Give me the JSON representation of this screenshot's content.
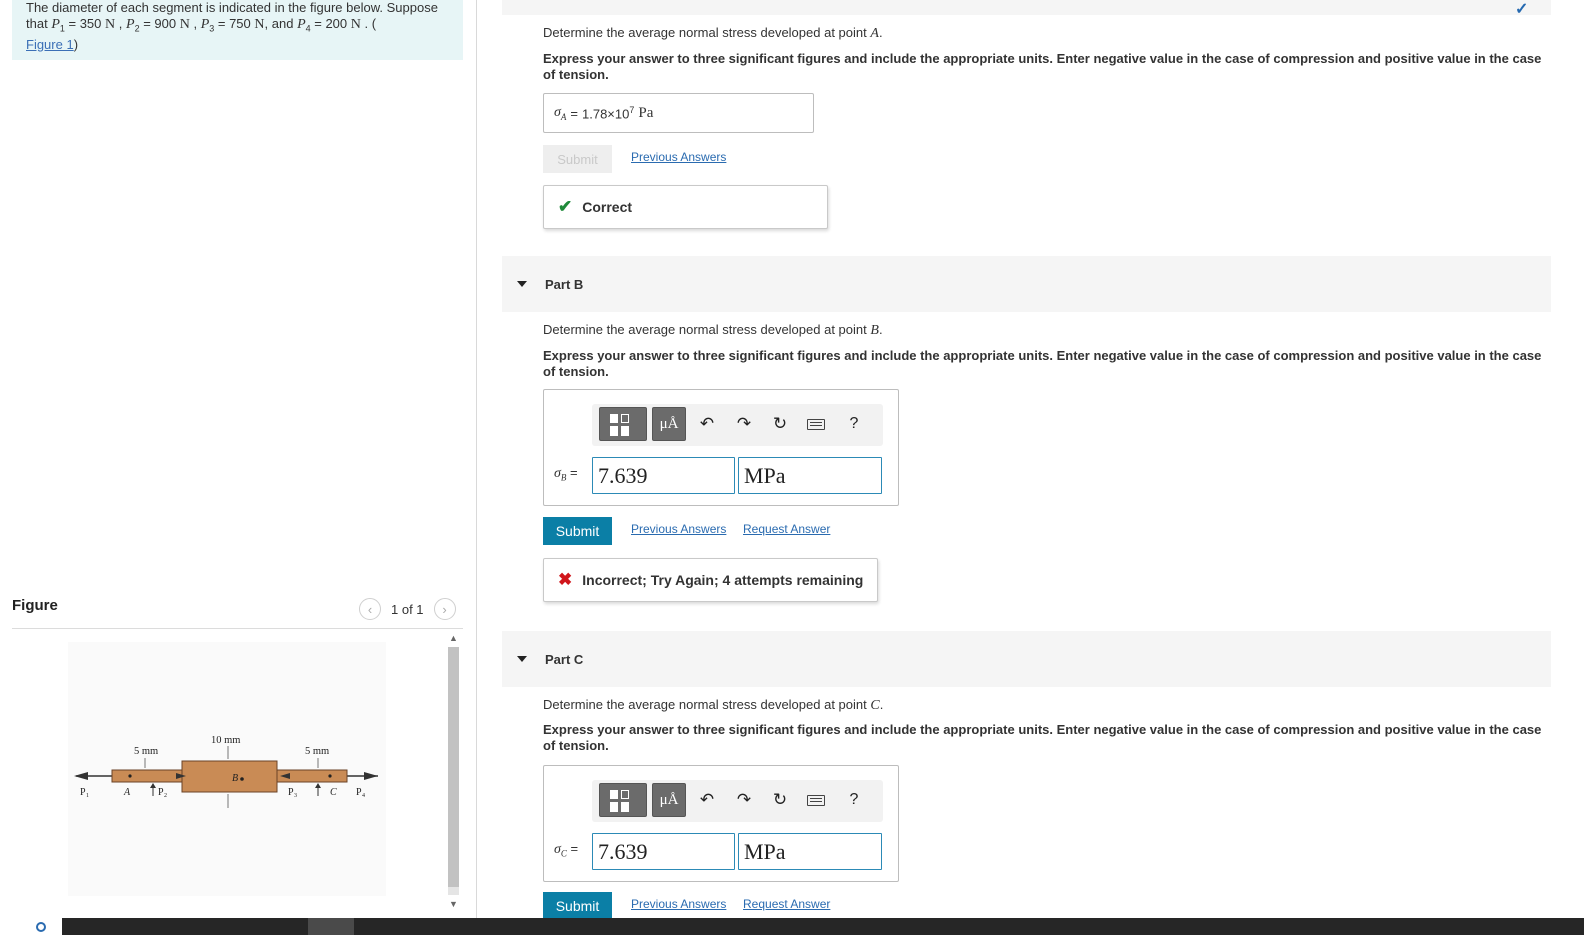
{
  "problem": {
    "line1": "The diameter of each segment is indicated in the figure below. Suppose",
    "line2_prefix": "that",
    "p1_var": "P",
    "p1_sub": "1",
    "p1_val": " = 350 ",
    "p2_var": "P",
    "p2_sub": "2",
    "p2_val": " = 900 ",
    "p3_var": "P",
    "p3_sub": "3",
    "p3_val": " = 750 ",
    "p4_var": "P",
    "p4_sub": "4",
    "p4_val": " = 200 ",
    "unit": "N",
    "and": ", and",
    "comma": " ,",
    "tail": " . (",
    "figure_link": "Figure 1",
    "close": ")"
  },
  "figure": {
    "title": "Figure",
    "pager": "1 of 1",
    "labels": {
      "left_dia": "5 mm",
      "mid_dia": "10 mm",
      "right_dia": "5 mm",
      "p1": "P",
      "p2": "P",
      "p3": "P",
      "p4": "P",
      "sub1": "1",
      "sub2": "2",
      "sub3": "3",
      "sub4": "4",
      "a": "A",
      "b": "B",
      "c": "C"
    }
  },
  "part_a": {
    "question": "Determine the average normal stress developed at point",
    "point": "A",
    "period": ".",
    "instructions": "Express your answer to three significant figures and include the appropriate units. Enter negative value in the case of compression and positive value in the case of tension.",
    "symbol": "σ",
    "symbol_sub": "A",
    "eq": " = ",
    "value": "1.78×10",
    "exp": "7",
    "unit": "Pa",
    "submit": "Submit",
    "previous": "Previous Answers",
    "feedback": "Correct"
  },
  "part_b": {
    "title": "Part B",
    "question": "Determine the average normal stress developed at point",
    "point": "B",
    "period": ".",
    "instructions": "Express your answer to three significant figures and include the appropriate units. Enter negative value in the case of compression and positive value in the case of tension.",
    "symbol": "σ",
    "symbol_sub": "B",
    "eq": " =",
    "value": "7.639",
    "unit": "MPa",
    "mu_label": "μÅ",
    "help": "?",
    "submit": "Submit",
    "previous": "Previous Answers",
    "request": "Request Answer",
    "feedback": "Incorrect; Try Again; 4 attempts remaining"
  },
  "part_c": {
    "title": "Part C",
    "question": "Determine the average normal stress developed at point",
    "point": "C",
    "period": ".",
    "instructions": "Express your answer to three significant figures and include the appropriate units. Enter negative value in the case of compression and positive value in the case of tension.",
    "symbol": "σ",
    "symbol_sub": "C",
    "eq": " =",
    "value": "7.639",
    "unit": "MPa",
    "mu_label": "μÅ",
    "help": "?",
    "submit": "Submit",
    "previous": "Previous Answers",
    "request": "Request Answer"
  },
  "colors": {
    "accent": "#0b7fa6",
    "link": "#2a6bb0",
    "correct": "#1f8a3a",
    "incorrect": "#d0161b",
    "problem_bg": "#e7f5f6",
    "bar_brown": "#c98b55"
  },
  "icons": {
    "check_top": "checkmark-icon",
    "undo": "undo-icon",
    "redo": "redo-icon",
    "reset": "reset-icon",
    "keyboard": "keyboard-icon",
    "help": "help-icon"
  }
}
